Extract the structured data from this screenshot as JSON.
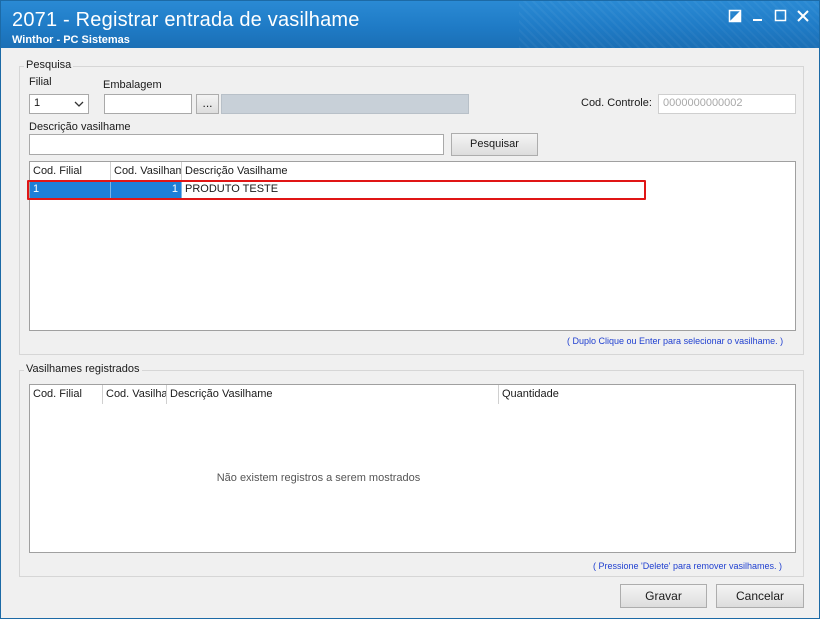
{
  "window": {
    "title": "2071 - Registrar entrada de vasilhame",
    "subtitle": "Winthor - PC Sistemas"
  },
  "pesquisa": {
    "legend": "Pesquisa",
    "filial_label": "Filial",
    "filial_value": "1",
    "embalagem_label": "Embalagem",
    "embalagem_value": "",
    "embalagem_button": "...",
    "embalagem_desc": "",
    "cod_controle_label": "Cod. Controle:",
    "cod_controle_value": "0000000000002",
    "descricao_label": "Descrição vasilhame",
    "descricao_value": "",
    "pesquisar_button": "Pesquisar",
    "grid": {
      "columns": [
        "Cod. Filial",
        "Cod. Vasilhame",
        "Descrição Vasilhame"
      ],
      "rows": [
        {
          "cod_filial": "1",
          "cod_vasilhame": "1",
          "descricao": "PRODUTO TESTE"
        }
      ]
    },
    "hint": "( Duplo Clique ou Enter para selecionar o vasilhame. )"
  },
  "registrados": {
    "legend": "Vasilhames registrados",
    "grid": {
      "columns": [
        "Cod. Filial",
        "Cod. Vasilhame",
        "Descrição Vasilhame",
        "Quantidade"
      ],
      "empty_message": "Não existem registros a serem mostrados"
    },
    "hint": "( Pressione 'Delete' para remover vasilhames. )"
  },
  "footer": {
    "gravar_button": "Gravar",
    "cancelar_button": "Cancelar"
  },
  "colors": {
    "titlebar": "#1f7bc6",
    "selection": "#1e7fd8",
    "highlight": "#e01515",
    "hint": "#1f3fd0"
  }
}
